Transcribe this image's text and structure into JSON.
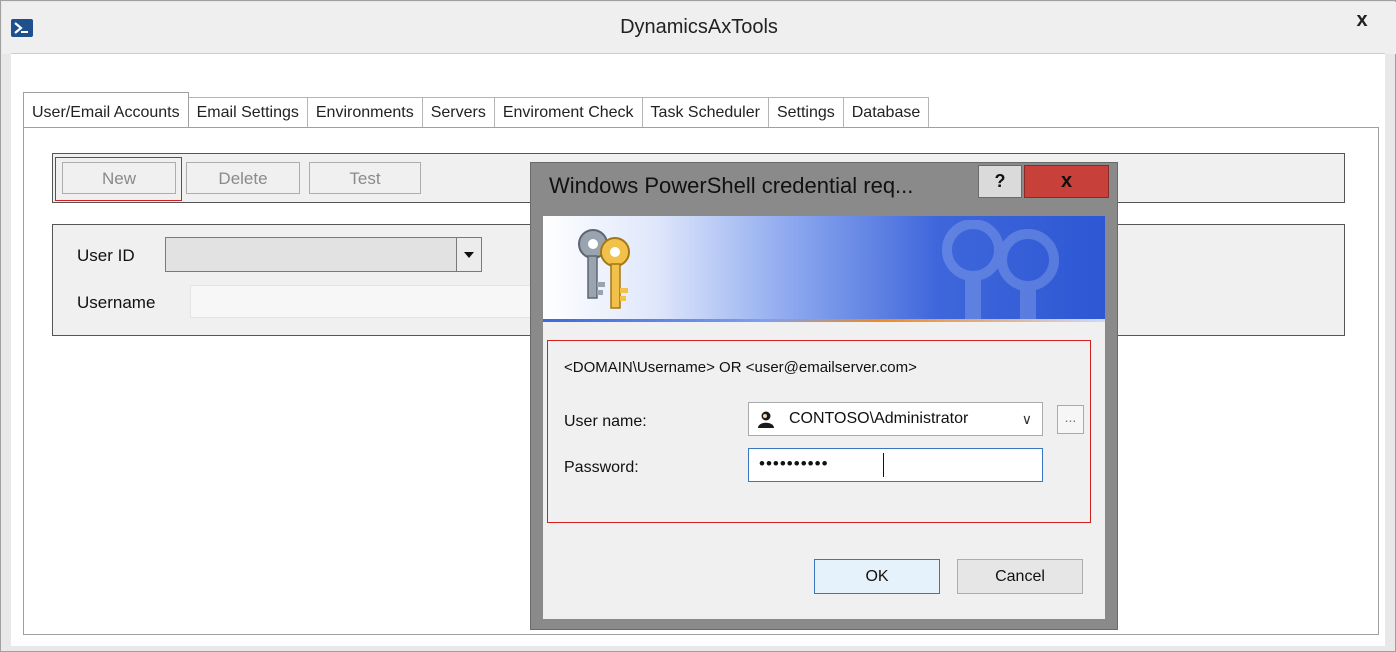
{
  "window": {
    "title": "DynamicsAxTools",
    "close_label": "x"
  },
  "tabs": [
    {
      "label": "User/Email Accounts",
      "active": true
    },
    {
      "label": "Email Settings"
    },
    {
      "label": "Environments"
    },
    {
      "label": "Servers"
    },
    {
      "label": "Enviroment Check"
    },
    {
      "label": "Task Scheduler"
    },
    {
      "label": "Settings"
    },
    {
      "label": "Database"
    }
  ],
  "toolbar": {
    "new_label": "New",
    "delete_label": "Delete",
    "test_label": "Test"
  },
  "user_form": {
    "user_id_label": "User ID",
    "user_id_value": "",
    "username_label": "Username",
    "username_value": ""
  },
  "credential_dialog": {
    "title": "Windows PowerShell credential req...",
    "help_label": "?",
    "close_label": "x",
    "hint": "<DOMAIN\\Username> OR <user@emailserver.com>",
    "username_label": "User name:",
    "username_value": "CONTOSO\\Administrator",
    "browse_label": "...",
    "password_label": "Password:",
    "password_mask": "••••••••••",
    "ok_label": "OK",
    "cancel_label": "Cancel"
  },
  "colors": {
    "highlight_border": "#d02020",
    "dialog_close": "#c7403a",
    "focus_blue": "#3b76c0"
  }
}
